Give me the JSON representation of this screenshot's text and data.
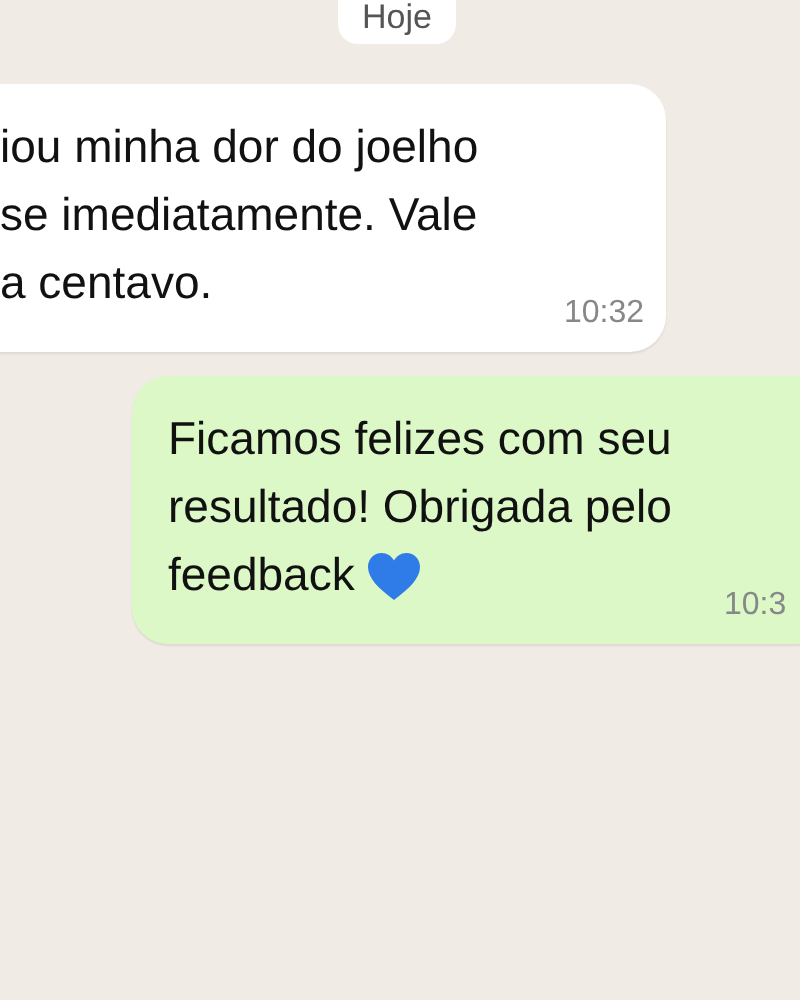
{
  "date_chip": "Hoje",
  "messages": [
    {
      "kind": "incoming",
      "lines": [
        "iou minha dor do joelho",
        "se imediatamente. Vale",
        "a centavo."
      ],
      "heart": false,
      "time": "10:32"
    },
    {
      "kind": "outgoing",
      "lines": [
        "Ficamos felizes com seu",
        "resultado! Obrigada pelo",
        "feedback"
      ],
      "heart": true,
      "time": "10:3"
    }
  ]
}
